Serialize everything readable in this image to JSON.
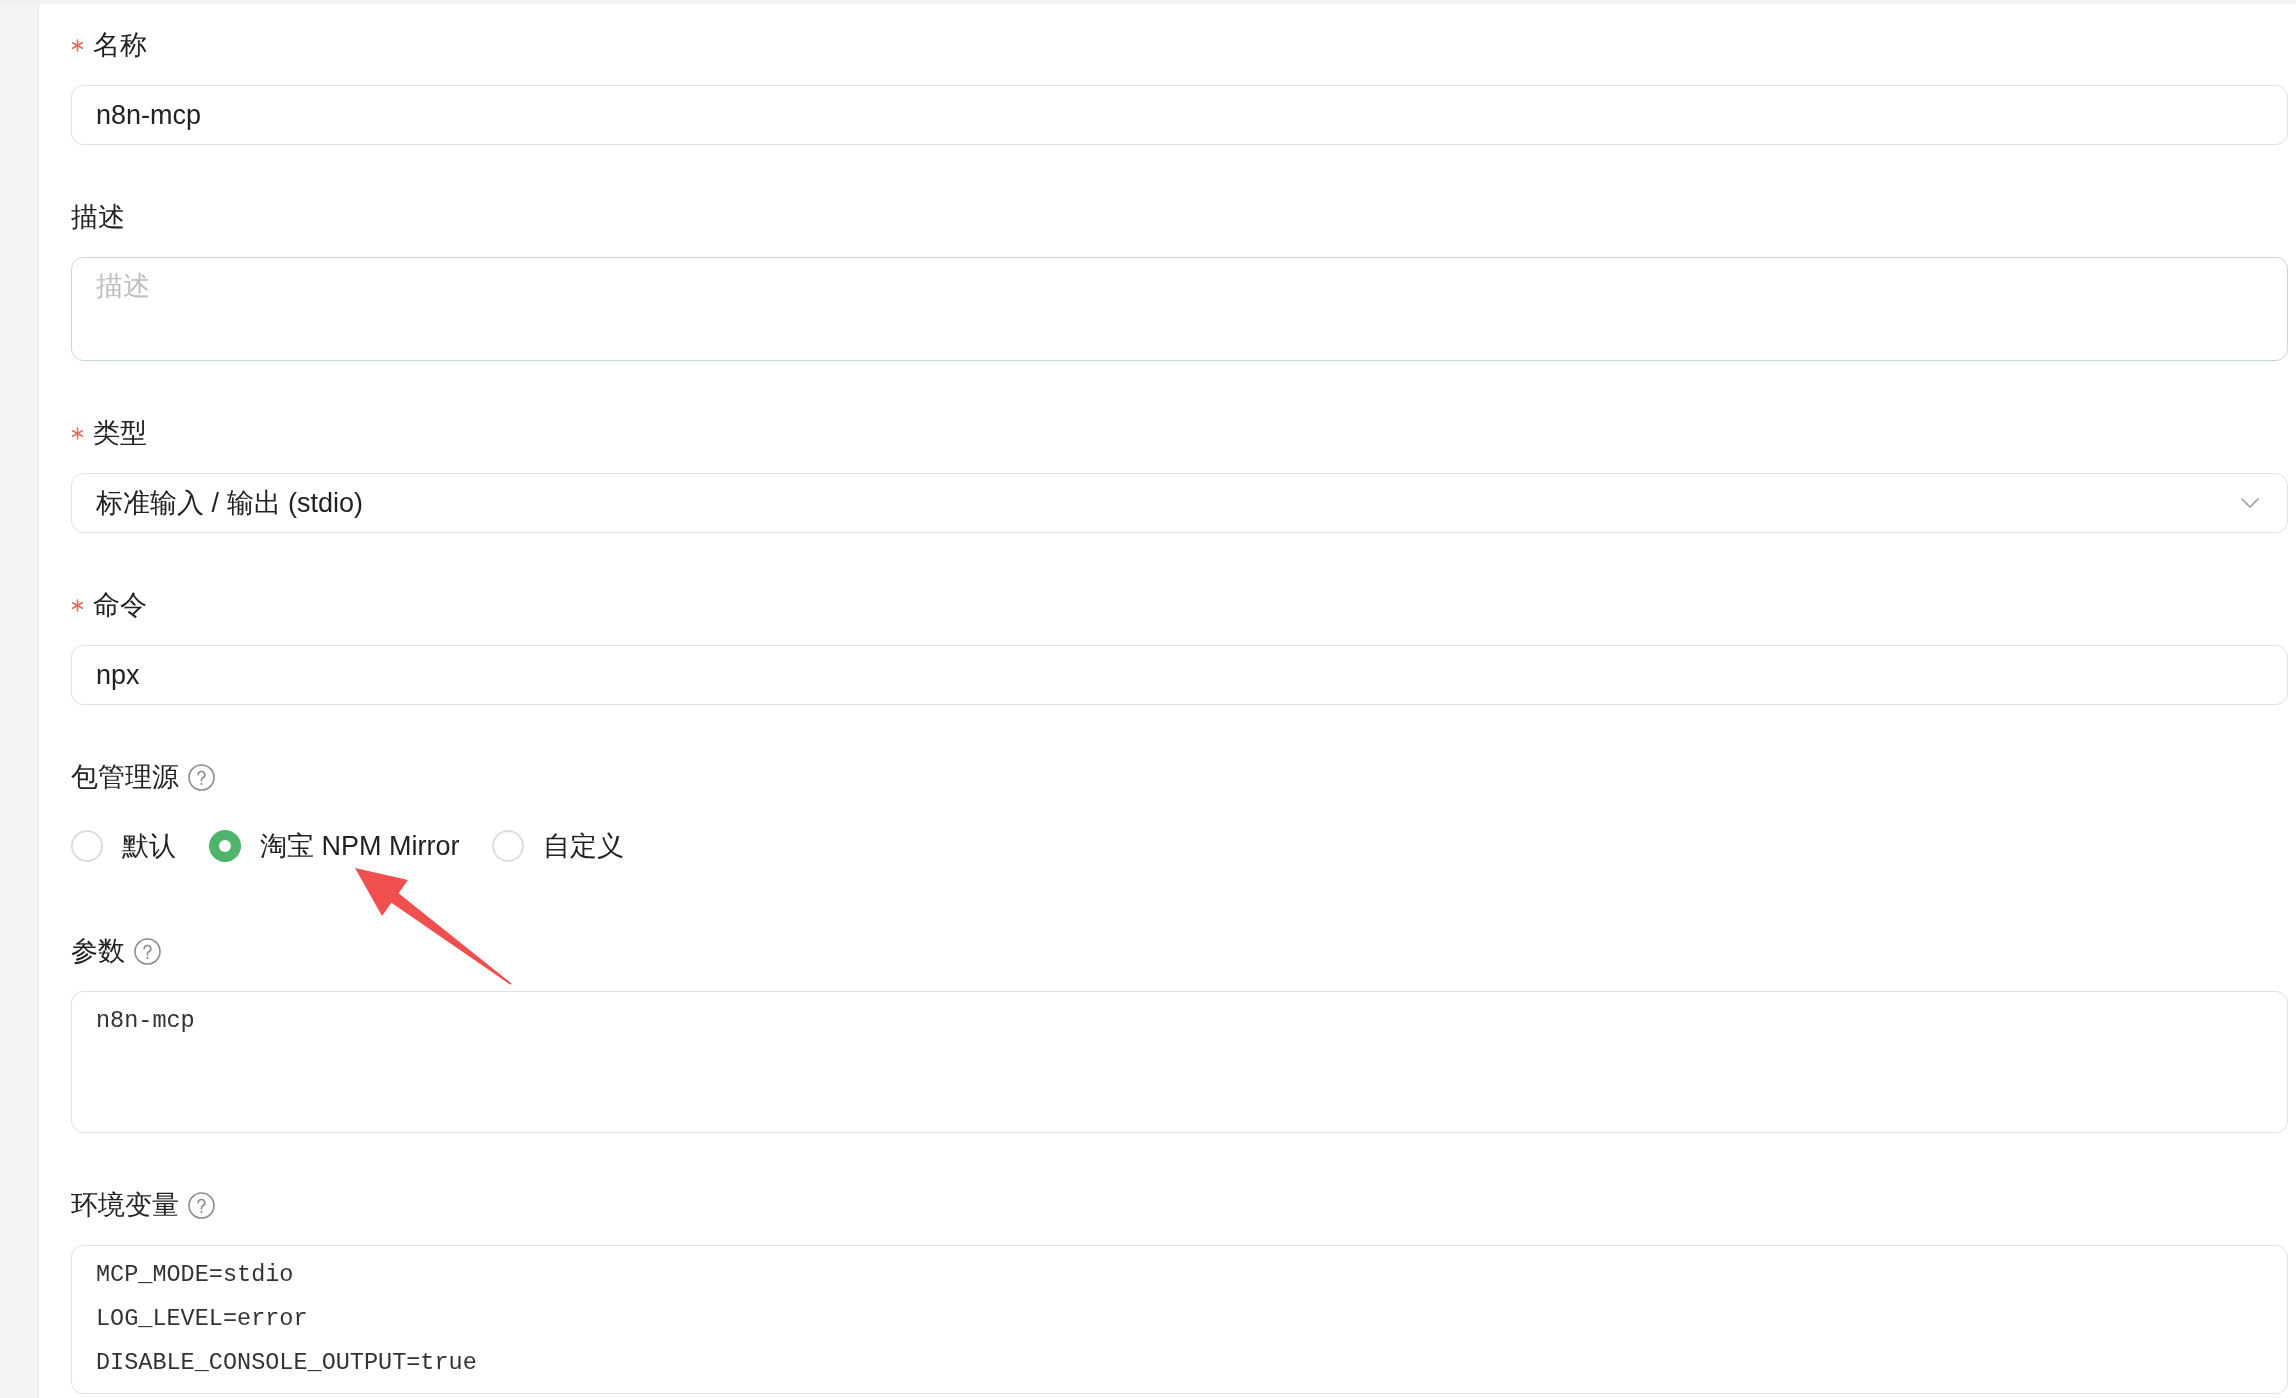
{
  "form": {
    "fields": [
      {
        "kind": "text",
        "label": "名称",
        "required": true,
        "help": false,
        "focused": false,
        "value": "n8n-mcp"
      },
      {
        "kind": "textarea",
        "label": "描述",
        "required": false,
        "help": false,
        "focused": true,
        "placeholder": "描述"
      },
      {
        "kind": "select",
        "label": "类型",
        "required": true,
        "help": false,
        "focused": false,
        "value": "标准输入 / 输出 (stdio)"
      },
      {
        "kind": "text",
        "label": "命令",
        "required": true,
        "help": false,
        "focused": false,
        "value": "npx"
      },
      {
        "kind": "radio",
        "label": "包管理源",
        "required": false,
        "help": true,
        "options": [
          {
            "label": "默认",
            "selected": false
          },
          {
            "label": "淘宝 NPM Mirror",
            "selected": true
          },
          {
            "label": "自定义",
            "selected": false
          }
        ]
      },
      {
        "kind": "code",
        "label": "参数",
        "required": false,
        "help": true,
        "focused": false,
        "lines": [
          "n8n-mcp"
        ]
      },
      {
        "kind": "code",
        "label": "环境变量",
        "required": false,
        "help": true,
        "focused": false,
        "lines": [
          "MCP_MODE=stdio",
          "LOG_LEVEL=error",
          "DISABLE_CONSOLE_OUTPUT=true"
        ]
      }
    ]
  },
  "annotations": [
    {
      "kind": "arrow"
    }
  ]
}
